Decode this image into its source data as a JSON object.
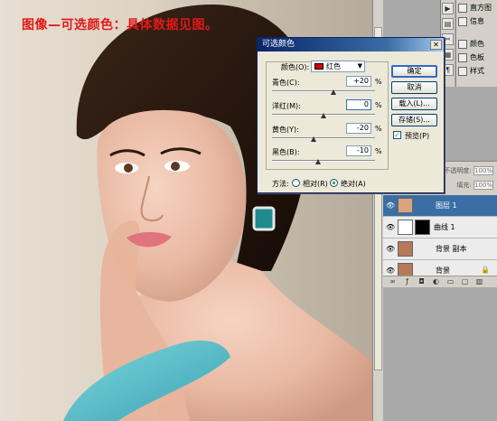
{
  "caption": "图像—可选颜色：具体数据见图。",
  "dialog": {
    "title": "可选颜色",
    "color_label": "颜色(O):",
    "color_value": "红色",
    "sliders": [
      {
        "label": "青色(C):",
        "value": "+20",
        "unit": "%",
        "fraction": 0.6
      },
      {
        "label": "洋红(M):",
        "value": "0",
        "unit": "%",
        "fraction": 0.5
      },
      {
        "label": "黄色(Y):",
        "value": "-20",
        "unit": "%",
        "fraction": 0.4
      },
      {
        "label": "黑色(B):",
        "value": "-10",
        "unit": "%",
        "fraction": 0.45
      }
    ],
    "method_label": "方法:",
    "relative_label": "相对(R)",
    "absolute_label": "绝对(A)",
    "selected_method": "绝对(A)",
    "ok_label": "确定",
    "cancel_label": "取消",
    "load_label": "载入(L)...",
    "save_label": "存储(S)...",
    "preview_label": "预览(P)",
    "preview_checked": true
  },
  "mini_panel": {
    "items": [
      "直方图",
      "信息",
      "颜色",
      "色板",
      "样式"
    ]
  },
  "layers_panel": {
    "opacity_label": "不透明度:",
    "opacity_value": "100%",
    "fill_label": "填充:",
    "fill_value": "100%",
    "layers": [
      {
        "name": "图层 1",
        "selected": true
      },
      {
        "name": "曲线 1",
        "selected": false
      },
      {
        "name": "背景 副本",
        "selected": false
      },
      {
        "name": "背景",
        "selected": false
      }
    ]
  },
  "colors": {
    "caption": "#e21818",
    "swatch_red": "#d40000",
    "selection": "#3a6ea5"
  }
}
